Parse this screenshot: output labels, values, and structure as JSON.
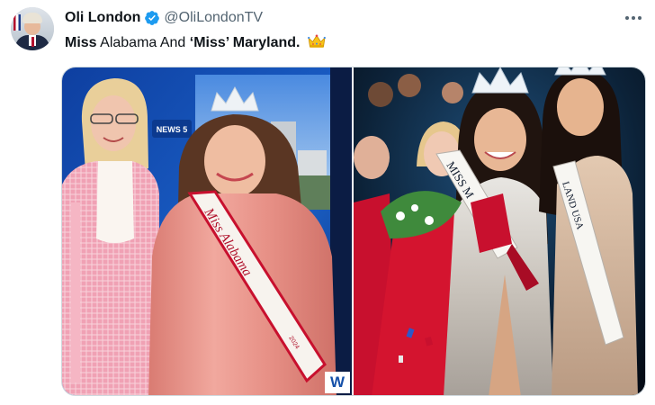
{
  "author": {
    "display_name": "Oli London",
    "handle": "@OliLondonTV",
    "verified": true,
    "avatar_icon": "profile-photo"
  },
  "menu": {
    "icon": "more-horizontal-icon"
  },
  "tweet": {
    "segments": [
      {
        "text": "Miss",
        "bold": true
      },
      {
        "text": " Alabama And ",
        "bold": false
      },
      {
        "text": "‘Miss’ Maryland.",
        "bold": true
      }
    ],
    "emoji": "crown-icon"
  },
  "media": {
    "left_photo": {
      "sash_text": "Miss Alabama",
      "sash_year": "2024",
      "station_logo": "NEWS 5",
      "watermark": "W"
    },
    "right_photo": {
      "sash_text": "MISS M",
      "sash_text_right": "LAND USA"
    }
  },
  "colors": {
    "verified_blue": "#1d9bf0",
    "text_primary": "#0f1419",
    "text_secondary": "#536471",
    "border": "#cfd9de",
    "dress_pink": "#e88f85",
    "dress_red": "#c8102e"
  }
}
